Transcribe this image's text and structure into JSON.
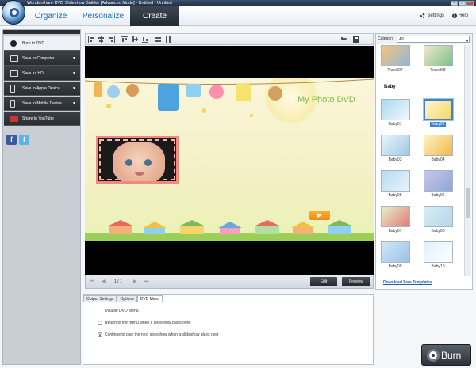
{
  "window": {
    "title": "Wondershare DVD Slideshow Builder [Advanced Mode] - Untitled - Untitled",
    "min_glyph": "–",
    "max_glyph": "□",
    "close_glyph": "×"
  },
  "nav": {
    "tabs": [
      {
        "label": "Organize"
      },
      {
        "label": "Personalize"
      },
      {
        "label": "Create"
      }
    ],
    "settings_label": "Settings",
    "help_label": "Help",
    "help_glyph": "?"
  },
  "sidebar": {
    "items": [
      {
        "label": "Burn to DVD",
        "icon": "disc-icon"
      },
      {
        "label": "Save to Computer",
        "icon": "monitor-icon"
      },
      {
        "label": "Save as HD",
        "icon": "hd-icon"
      },
      {
        "label": "Save to Apple Device",
        "icon": "iphone-icon"
      },
      {
        "label": "Save to Mobile Device",
        "icon": "mobile-icon"
      },
      {
        "label": "Share to YouTube",
        "icon": "youtube-icon"
      }
    ],
    "arrow_glyph": "▼",
    "facebook_glyph": "f",
    "twitter_glyph": "t"
  },
  "preview": {
    "menu_title": "My Photo DVD",
    "page_indicator": "1 / 1",
    "edit_label": "Edit",
    "preview_label": "Preview",
    "first_glyph": "⏮",
    "prev_glyph": "◀",
    "next_glyph": "▶",
    "last_glyph": "⏭"
  },
  "options": {
    "tabs": [
      {
        "label": "Output Settings"
      },
      {
        "label": "Options"
      },
      {
        "label": "DVD Menu"
      }
    ],
    "active_tab": "DVD Menu",
    "disable_menu_label": "Disable DVD Menu",
    "return_label": "Return to the menu when a slideshow plays over",
    "continue_label": "Continue to play the next slideshow when a slideshow plays over",
    "selected_radio": "continue"
  },
  "templates": {
    "category_label": "Category",
    "category_value": "All",
    "category_arrow": "▾",
    "section_label": "Baby",
    "items": [
      {
        "name": "Travel07",
        "color1": "#f4c77a",
        "color2": "#8fb6d8"
      },
      {
        "name": "Travel08",
        "color1": "#eee8c8",
        "color2": "#7ec08a"
      },
      {
        "name": "Baby01",
        "color1": "#a9d9f0",
        "color2": "#f2f8fb"
      },
      {
        "name": "Baby02",
        "color1": "#fff6cc",
        "color2": "#f5d66a"
      },
      {
        "name": "Baby03",
        "color1": "#e9f4fb",
        "color2": "#9fc9e6"
      },
      {
        "name": "Baby04",
        "color1": "#fff3c4",
        "color2": "#f1b84a"
      },
      {
        "name": "Baby05",
        "color1": "#b9dbf2",
        "color2": "#e7f3fb"
      },
      {
        "name": "Baby06",
        "color1": "#c9c7ea",
        "color2": "#8fa5d8"
      },
      {
        "name": "Baby07",
        "color1": "#e6f2c8",
        "color2": "#e07a7a"
      },
      {
        "name": "Baby08",
        "color1": "#d6eef2",
        "color2": "#b6d6e8"
      },
      {
        "name": "Baby09",
        "color1": "#d2e6f6",
        "color2": "#9ac2e6"
      },
      {
        "name": "Baby10",
        "color1": "#dff0fa",
        "color2": "#ffffff"
      }
    ],
    "selected": "Baby02",
    "download_label": "Download Free Templates"
  },
  "burn": {
    "label": "Burn"
  }
}
